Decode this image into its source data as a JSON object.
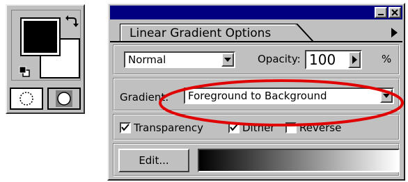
{
  "toolbox": {
    "swap_icon": "swap-arrows-icon",
    "default_colors_icon": "default-colors-icon",
    "foreground_color": "#000000",
    "background_color": "#ffffff",
    "modes": [
      {
        "name": "standard-mode-icon"
      },
      {
        "name": "quick-mask-mode-icon"
      }
    ]
  },
  "palette": {
    "tab_label": "Linear Gradient Options",
    "blend_mode": "Normal",
    "opacity_label": "Opacity:",
    "opacity_value": "100",
    "opacity_unit": "%",
    "gradient_label": "Gradient:",
    "gradient_value": "Foreground to Background",
    "checkboxes": [
      {
        "label": "Transparency",
        "checked": true
      },
      {
        "label": "Dither",
        "checked": true
      },
      {
        "label": "Reverse",
        "checked": false
      }
    ],
    "edit_label": "Edit...",
    "gradient_start": "#000000",
    "gradient_end": "#ffffff"
  },
  "annotation": {
    "color": "#e00000"
  }
}
